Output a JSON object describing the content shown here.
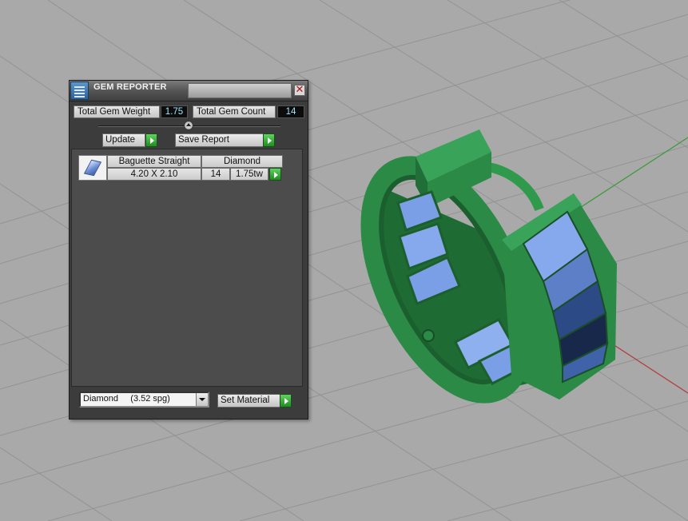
{
  "panel": {
    "title": "GEM REPORTER",
    "close_icon": "close-icon",
    "app_icon": "gem-report-icon",
    "total_gem_weight_label": "Total Gem Weight",
    "total_gem_weight_value": "1.75",
    "total_gem_count_label": "Total Gem Count",
    "total_gem_count_value": "14",
    "update_label": "Update",
    "save_report_label": "Save Report",
    "gem_rows": [
      {
        "shape": "Baguette Straight",
        "material": "Diamond",
        "size": "4.20 X 2.10",
        "count": "14",
        "weight": "1.75tw"
      }
    ],
    "material_select": {
      "value": "Diamond     (3.52 spg)"
    },
    "set_material_label": "Set Material"
  },
  "colors": {
    "viewport_bg": "#a9a9a9",
    "grid": "#8f8f8f",
    "axis_red": "#b43c3c",
    "axis_green": "#3c9a3c",
    "ring_metal": "#2b8a45",
    "gem_blue": "#7a9fe6",
    "value_text": "#9fe6ff"
  }
}
